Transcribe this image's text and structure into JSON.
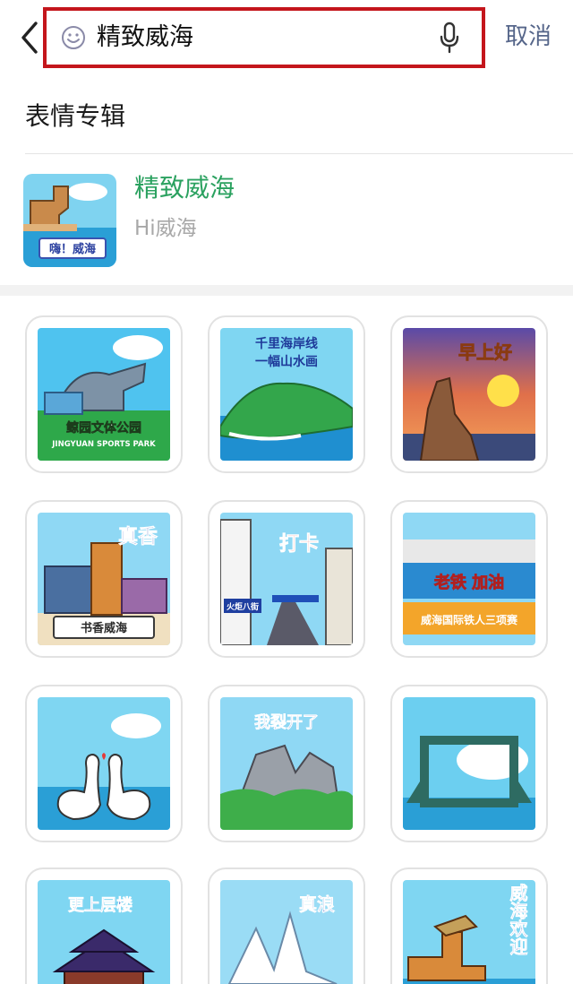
{
  "topbar": {
    "query": "精致威海",
    "cancel_label": "取消"
  },
  "section": {
    "title": "表情专辑"
  },
  "album": {
    "name": "精致威海",
    "subtitle": "Hi威海",
    "thumb_caption": "嗨！威海"
  },
  "stickers": [
    {
      "caption": "鲸园文体公园",
      "caption2": "JINGYUAN SPORTS PARK"
    },
    {
      "caption": "千里海岸线",
      "caption2": "一幅山水画"
    },
    {
      "caption": "早上好"
    },
    {
      "caption": "真香",
      "caption2": "书香威海"
    },
    {
      "caption": "打卡",
      "caption2": "火炬八街"
    },
    {
      "caption": "老铁 加油",
      "caption2": "威海国际铁人三项赛"
    },
    {
      "caption": ""
    },
    {
      "caption": "我裂开了"
    },
    {
      "caption": ""
    },
    {
      "caption": "更上层楼"
    },
    {
      "caption": "真浪"
    },
    {
      "caption": "威海欢迎"
    }
  ]
}
